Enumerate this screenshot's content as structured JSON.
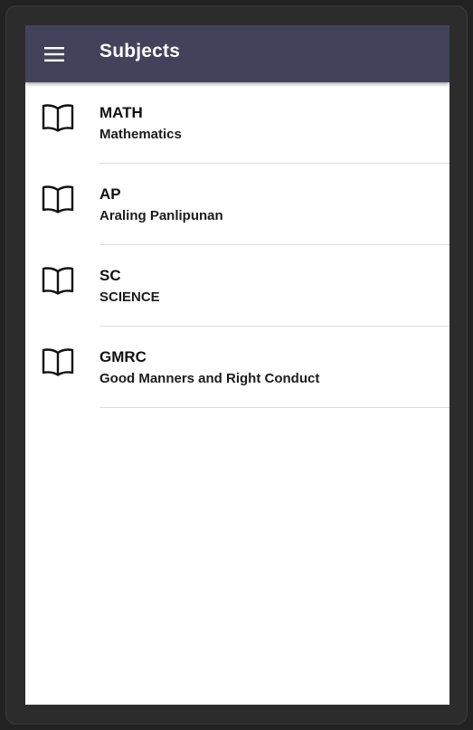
{
  "appbar": {
    "menu_icon": "menu-icon",
    "title": "Subjects",
    "background_color": "#42435a"
  },
  "subjects": [
    {
      "icon": "book-icon",
      "code": "MATH",
      "name": "Mathematics"
    },
    {
      "icon": "book-icon",
      "code": "AP",
      "name": "Araling Panlipunan"
    },
    {
      "icon": "book-icon",
      "code": "SC",
      "name": "SCIENCE"
    },
    {
      "icon": "book-icon",
      "code": "GMRC",
      "name": "Good Manners and Right Conduct"
    }
  ]
}
